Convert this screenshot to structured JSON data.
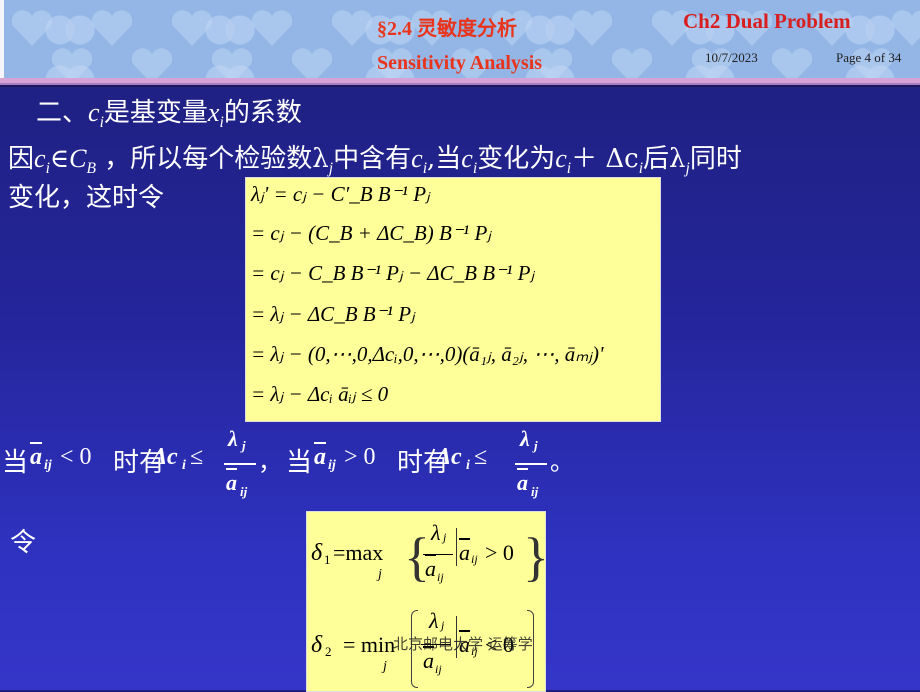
{
  "header": {
    "section_title_cn": "§2.4 灵敏度分析",
    "section_title_en": "Sensitivity Analysis",
    "chapter": "Ch2 Dual Problem",
    "date": "10/7/2023",
    "page": "Page 4 of 34"
  },
  "body": {
    "heading": {
      "prefix": "二、",
      "var_c": "c",
      "sub_i": "i",
      "mid": "是基变量",
      "var_x": "x",
      "sub_i2": "i",
      "suffix": "的系数"
    },
    "para1": {
      "t1": "因",
      "c": "c",
      "i": "i",
      "in": "∈",
      "CB": "C",
      "B": "B",
      "t2": " ，所以每个检验数λ",
      "j": "j",
      "t3": "中含有",
      "c2": "c",
      "i2": "i",
      "t4": ",当",
      "c3": "c",
      "i3": "i",
      "t5": "变化为",
      "c4": "c",
      "i4": "i",
      "t6": "＋  Δc",
      "i5": "i",
      "t7": "后λ",
      "j2": "j",
      "t8": "同时"
    },
    "para2": "变化，这时令",
    "equations": [
      "λⱼ' = cⱼ − C′_B B⁻¹ Pⱼ",
      "= cⱼ − (C_B + ΔC_B) B⁻¹ Pⱼ",
      "= cⱼ − C_B B⁻¹ Pⱼ − ΔC_B B⁻¹ Pⱼ",
      "= λⱼ − ΔC_B B⁻¹ Pⱼ",
      "= λⱼ − (0,⋯,0,Δcᵢ,0,⋯,0)(ā₁ⱼ, ā₂ⱼ, ⋯, āₘⱼ)'",
      "= λⱼ − Δcᵢ āᵢⱼ ≤ 0"
    ],
    "condition": {
      "when1": "当",
      "a": "a",
      "ij": "ij",
      "lt0": " < 0",
      "then1": "时有",
      "dc": "Δc",
      "i": "i",
      "le": " ≤ ",
      "lam": "λ",
      "j": "j",
      "comma": "，",
      "when2": "当",
      "gt0": " > 0",
      "then2": "时有",
      "period": "。"
    },
    "ling": "令",
    "delta1": {
      "lhs": "δ",
      "sub": "1",
      "op": "=max",
      "under": "j",
      "cond": "> 0"
    },
    "delta2": {
      "lhs": "δ",
      "sub": "2",
      "op": "= min",
      "under": "j",
      "cond": "< 0"
    },
    "footer": "北京邮电大学 运筹学"
  }
}
